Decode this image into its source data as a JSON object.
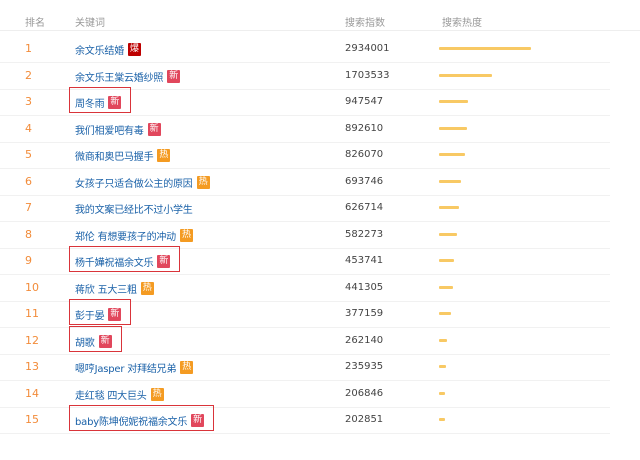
{
  "header": {
    "rank": "排名",
    "keyword": "关键词",
    "index": "搜索指数",
    "heat": "搜索热度"
  },
  "colors": {
    "rank": "#f28c3a",
    "keyword": "#1a61a8",
    "badge_new": "#e1475c",
    "badge_hot": "#f49b22",
    "badge_boom": "#bd0000",
    "bar": "#f8c964",
    "highlight": "#d9343a"
  },
  "rows": [
    {
      "rank": "1",
      "keyword": "余文乐结婚",
      "badge": "爆",
      "badge_type": "bao",
      "index": "2934001",
      "heat": 1.0,
      "highlighted": false
    },
    {
      "rank": "2",
      "keyword": "余文乐王棠云婚纱照",
      "badge": "新",
      "badge_type": "xin",
      "index": "1703533",
      "heat": 0.58,
      "highlighted": false
    },
    {
      "rank": "3",
      "keyword": "周冬雨",
      "badge": "新",
      "badge_type": "xin",
      "index": "947547",
      "heat": 0.32,
      "highlighted": true
    },
    {
      "rank": "4",
      "keyword": "我们相爱吧有毒",
      "badge": "新",
      "badge_type": "xin",
      "index": "892610",
      "heat": 0.3,
      "highlighted": false
    },
    {
      "rank": "5",
      "keyword": "微商和奥巴马握手",
      "badge": "热",
      "badge_type": "re",
      "index": "826070",
      "heat": 0.28,
      "highlighted": false
    },
    {
      "rank": "6",
      "keyword": "女孩子只适合做公主的原因",
      "badge": "热",
      "badge_type": "re",
      "index": "693746",
      "heat": 0.24,
      "highlighted": false
    },
    {
      "rank": "7",
      "keyword": "我的文案已经比不过小学生",
      "badge": "",
      "badge_type": "",
      "index": "626714",
      "heat": 0.22,
      "highlighted": false
    },
    {
      "rank": "8",
      "keyword": "郑伦 有想要孩子的冲动",
      "badge": "热",
      "badge_type": "re",
      "index": "582273",
      "heat": 0.2,
      "highlighted": false
    },
    {
      "rank": "9",
      "keyword": "杨千嬅祝福余文乐",
      "badge": "新",
      "badge_type": "xin",
      "index": "453741",
      "heat": 0.16,
      "highlighted": true
    },
    {
      "rank": "10",
      "keyword": "蒋欣 五大三粗",
      "badge": "热",
      "badge_type": "re",
      "index": "441305",
      "heat": 0.155,
      "highlighted": false
    },
    {
      "rank": "11",
      "keyword": "彭于晏",
      "badge": "新",
      "badge_type": "xin",
      "index": "377159",
      "heat": 0.13,
      "highlighted": true
    },
    {
      "rank": "12",
      "keyword": "胡歌",
      "badge": "新",
      "badge_type": "xin",
      "index": "262140",
      "heat": 0.09,
      "highlighted": true
    },
    {
      "rank": "13",
      "keyword": "嗯哼Jasper 对拜结兄弟",
      "badge": "热",
      "badge_type": "re",
      "index": "235935",
      "heat": 0.08,
      "highlighted": false
    },
    {
      "rank": "14",
      "keyword": "走红毯 四大巨头",
      "badge": "热",
      "badge_type": "re",
      "index": "206846",
      "heat": 0.07,
      "highlighted": false
    },
    {
      "rank": "15",
      "keyword": "baby陈坤倪妮祝福余文乐",
      "badge": "新",
      "badge_type": "xin",
      "index": "202851",
      "heat": 0.07,
      "highlighted": true
    }
  ]
}
